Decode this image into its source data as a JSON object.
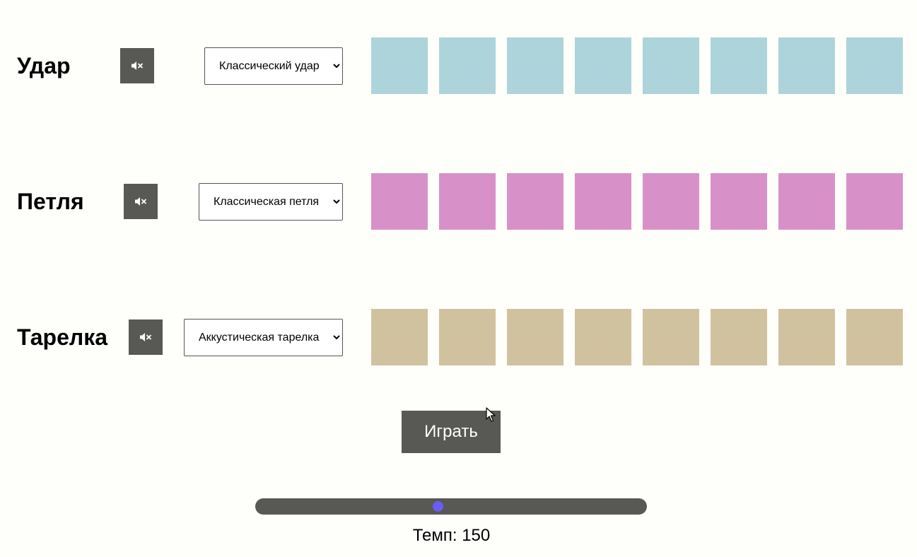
{
  "tracks": [
    {
      "id": "kick",
      "title": "Удар",
      "mute_icon": "speaker-muted-icon",
      "selected_sound": "Классический удар",
      "color": "#add4da",
      "pads": 8
    },
    {
      "id": "snare",
      "title": "Петля",
      "mute_icon": "speaker-muted-icon",
      "selected_sound": "Классическая петля",
      "color": "#d891c8",
      "pads": 8
    },
    {
      "id": "hihat",
      "title": "Тарелка",
      "mute_icon": "speaker-muted-icon",
      "selected_sound": "Аккустическая тарелка",
      "color": "#d1c29f",
      "pads": 8
    }
  ],
  "controls": {
    "play_label": "Играть",
    "tempo_label": "Темп: 150",
    "tempo_fraction": 0.466
  },
  "colors": {
    "button_bg": "#585854",
    "slider_thumb": "#6b5cf6",
    "page_bg": "#fefefb"
  }
}
